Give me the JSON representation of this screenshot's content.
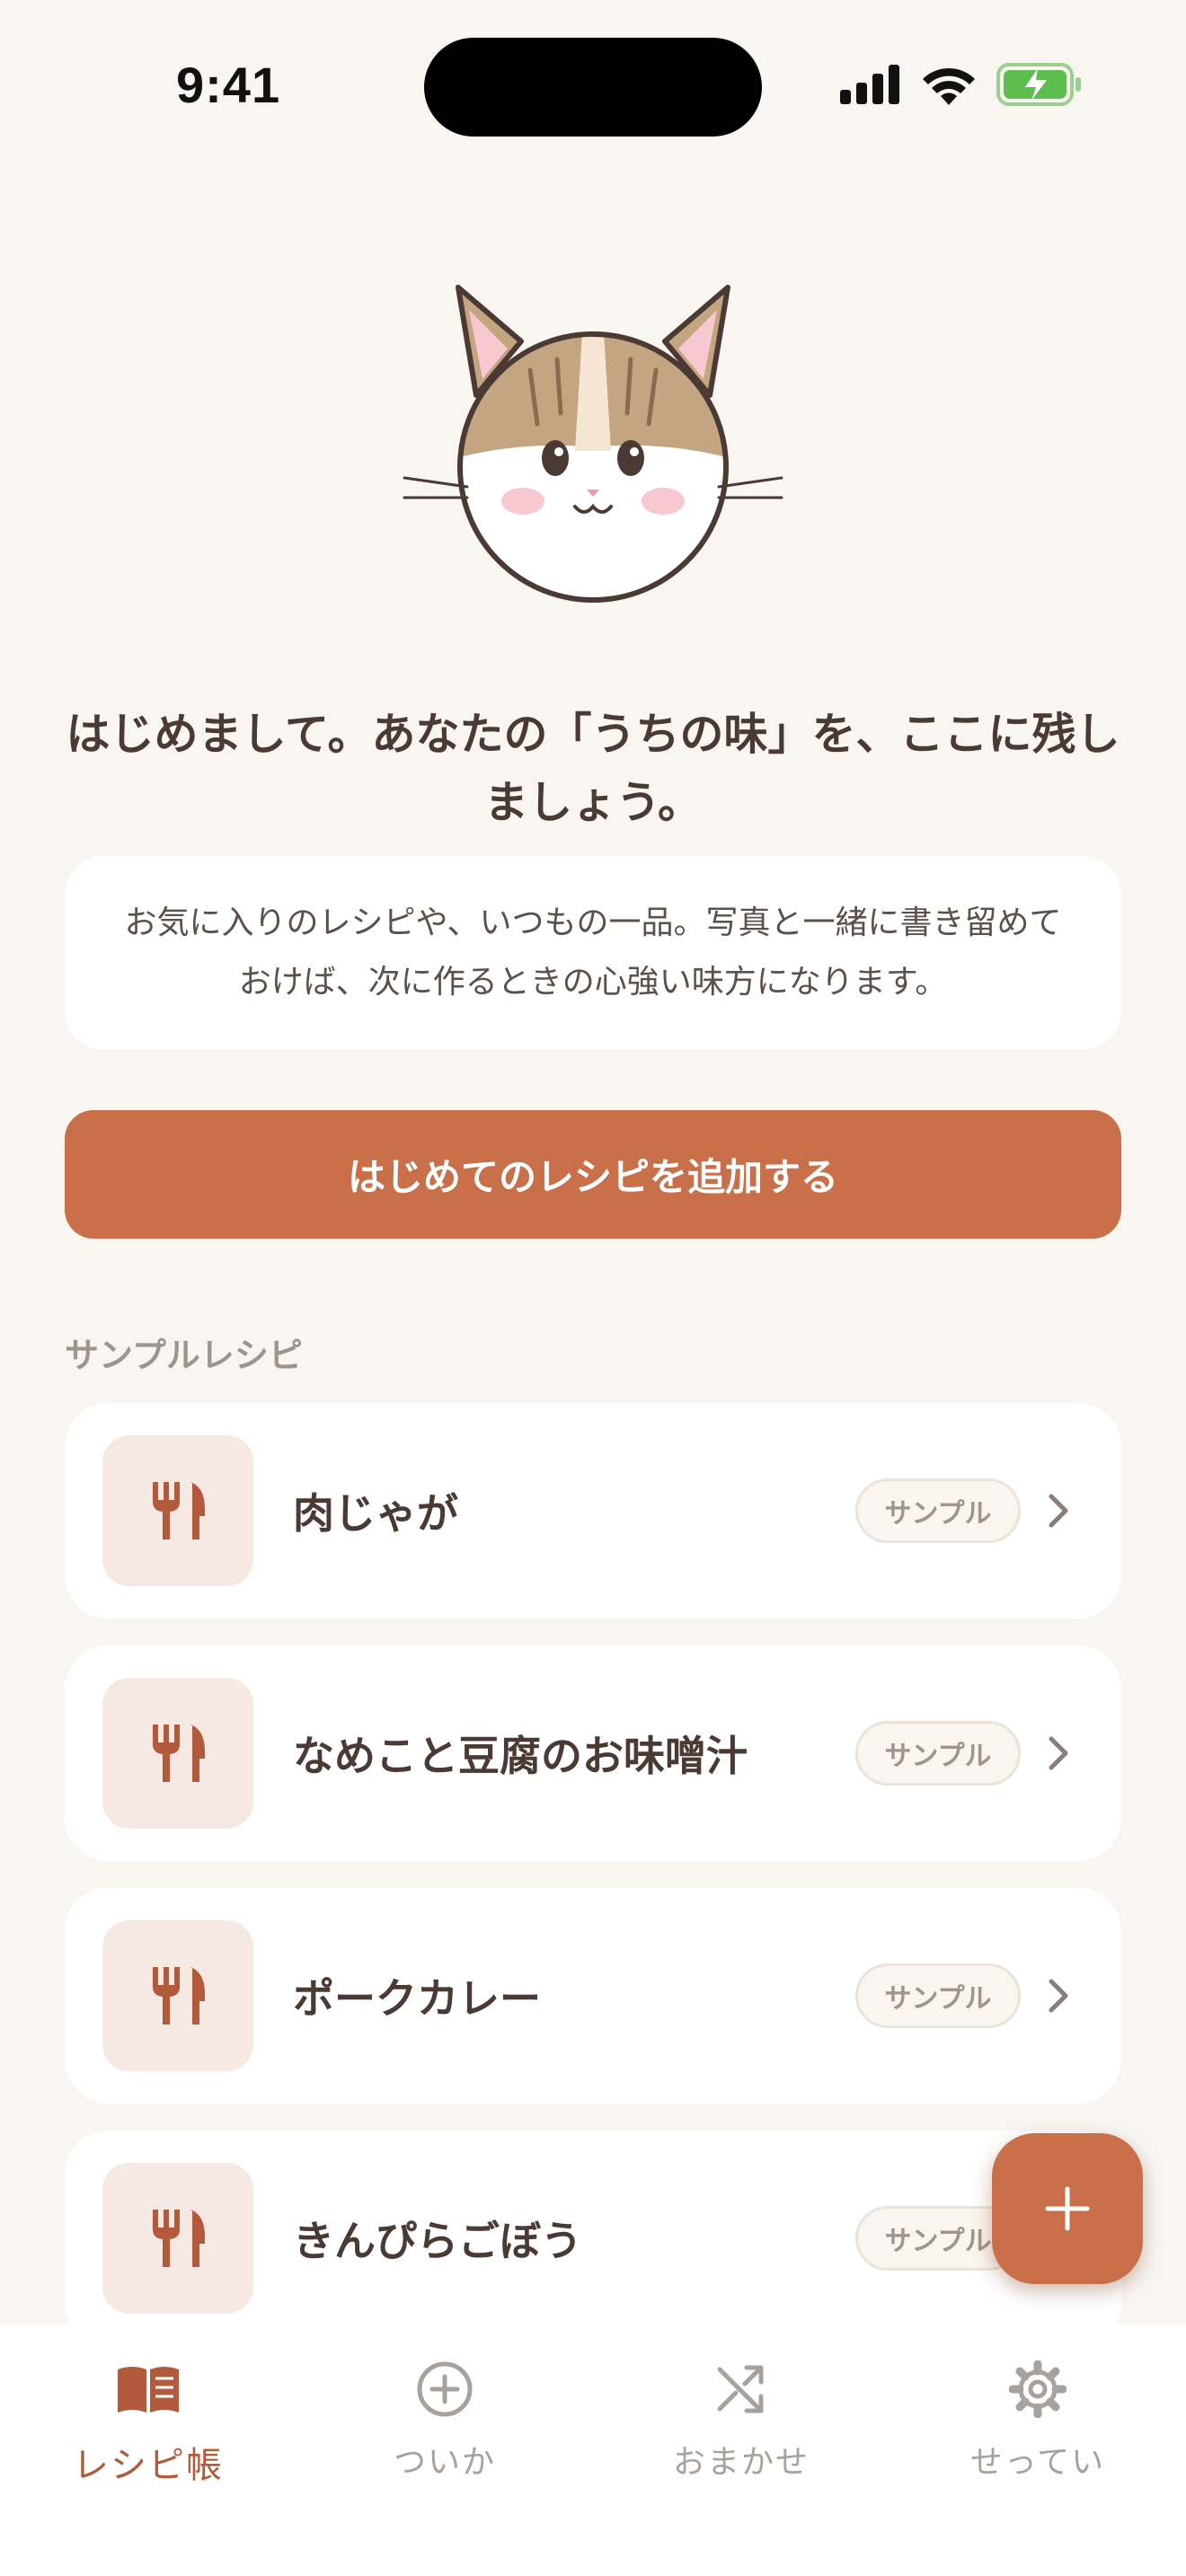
{
  "status_bar": {
    "time": "9:41",
    "battery_icon": "battery-charging-icon",
    "wifi_icon": "wifi-icon",
    "signal_icon": "signal-icon"
  },
  "onboarding": {
    "mascot": "cat-mascot",
    "headline": "はじめまして。あなたの「うちの味」を、ここに残しましょう。",
    "description": "お気に入りのレシピや、いつもの一品。写真と一緒に書き留めておけば、次に作るときの心強い味方になります。",
    "primary_button": "はじめてのレシピを追加する"
  },
  "samples": {
    "section_label": "サンプルレシピ",
    "items": [
      {
        "title": "肉じゃが",
        "badge": "サンプル",
        "icon": "utensils-icon"
      },
      {
        "title": "なめこと豆腐のお味噌汁",
        "badge": "サンプル",
        "icon": "utensils-icon"
      },
      {
        "title": "ポークカレー",
        "badge": "サンプル",
        "icon": "utensils-icon"
      },
      {
        "title": "きんぴらごぼう",
        "badge": "サンプル",
        "icon": "utensils-icon"
      }
    ]
  },
  "fab": {
    "icon": "plus-icon"
  },
  "tab_bar": {
    "tabs": [
      {
        "label": "レシピ帳",
        "icon": "book-icon",
        "active": true
      },
      {
        "label": "ついか",
        "icon": "add-circle-icon",
        "active": false
      },
      {
        "label": "おまかせ",
        "icon": "shuffle-icon",
        "active": false
      },
      {
        "label": "せってい",
        "icon": "gear-icon",
        "active": false
      }
    ]
  },
  "colors": {
    "accent": "#c96f4a",
    "background": "#f9f6f2",
    "text": "#4a3a33",
    "muted": "#a0958c"
  }
}
